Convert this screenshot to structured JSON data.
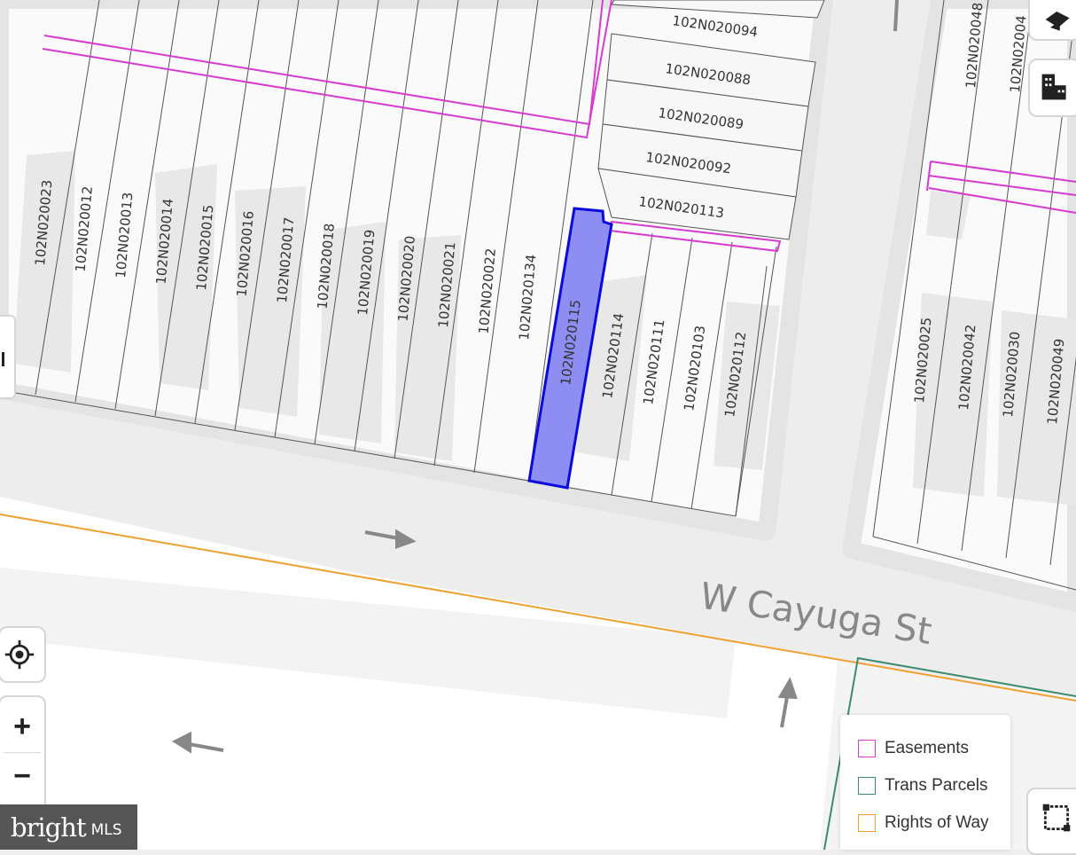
{
  "street": {
    "name": "W Cayuga St"
  },
  "parcels_top": [
    "102N020094",
    "102N020088",
    "102N020089",
    "102N020092",
    "102N020113"
  ],
  "parcels_main": [
    "102N020023",
    "102N020012",
    "102N020013",
    "102N020014",
    "102N020015",
    "102N020016",
    "102N020017",
    "102N020018",
    "102N020019",
    "102N020020",
    "102N020021",
    "102N020022",
    "102N020134"
  ],
  "selected_parcel": "102N020115",
  "parcels_right_of_selected": [
    "102N020114",
    "102N020111",
    "102N020103",
    "102N020112"
  ],
  "parcels_far_right": [
    "102N020025",
    "102N020042",
    "102N020030",
    "102N020049"
  ],
  "parcels_top_right": [
    "102N020048",
    "102N02004"
  ],
  "legend": {
    "items": [
      {
        "label": "Easements",
        "color": "#d63ad0"
      },
      {
        "label": "Trans Parcels",
        "color": "#3a8a6e"
      },
      {
        "label": "Rights of Way",
        "color": "#f0a030"
      }
    ]
  },
  "controls": {
    "locate_icon": "locate-target-icon",
    "zoom_in": "+",
    "zoom_out": "−"
  },
  "brand": {
    "main": "bright",
    "sub": "MLS"
  },
  "colors": {
    "selected_fill": "#8e8ef2",
    "selected_stroke": "#0a0adc",
    "easement": "#d63ad0",
    "right_of_way": "#f0a030",
    "trans_parcel": "#3a8a6e",
    "parcel_line": "#555555"
  }
}
